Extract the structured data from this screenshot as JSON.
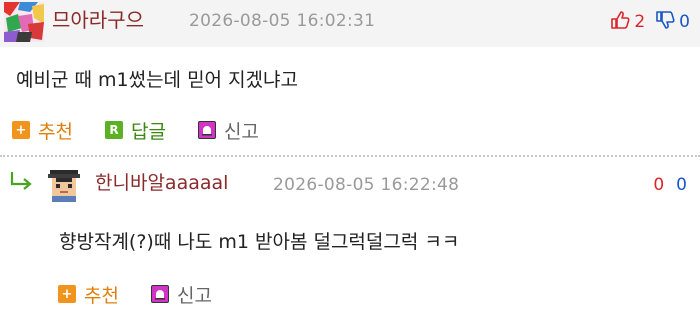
{
  "colors": {
    "author": "#8b2a2a",
    "date": "#9a9a9a",
    "upvote": "#d9262c",
    "downvote": "#1a57c4",
    "recommend": "#e0800c",
    "reply": "#3a8a10",
    "report": "#666666",
    "header_bg": "#f4f4f4"
  },
  "comment": {
    "author": "므아라구으",
    "date": "2026-08-05  16:02:31",
    "upvotes": "2",
    "downvotes": "0",
    "upvote_icon": "thumbs-up-icon",
    "downvote_icon": "thumbs-down-icon",
    "text": "예비군 때 m1썼는데 믿어 지겠냐고",
    "actions": {
      "recommend_label": "추천",
      "reply_label": "답글",
      "report_label": "신고"
    }
  },
  "reply": {
    "author": "한니바알aaaaal",
    "date": "2026-08-05  16:22:48",
    "upvotes": "0",
    "downvotes": "0",
    "text": "향방작계(?)때 나도 m1 받아봄 덜그럭덜그럭 ㅋㅋ",
    "actions": {
      "recommend_label": "추천",
      "report_label": "신고"
    }
  }
}
